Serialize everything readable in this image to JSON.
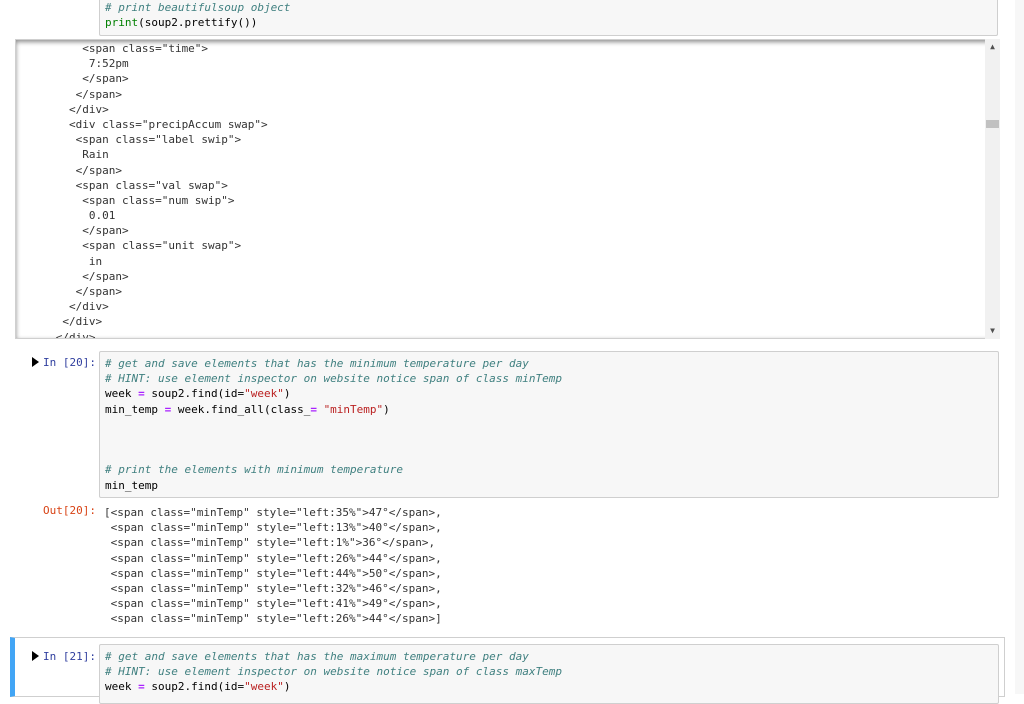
{
  "top_cell": {
    "comment": "# print beautifulsoup object",
    "code_builtin": "print",
    "code_rest": "(soup2.prettify())"
  },
  "scroll_output": {
    "lines": [
      "          <span class=\"time\">",
      "           7:52pm",
      "          </span>",
      "         </span>",
      "        </div>",
      "        <div class=\"precipAccum swap\">",
      "         <span class=\"label swip\">",
      "          Rain",
      "         </span>",
      "         <span class=\"val swap\">",
      "          <span class=\"num swip\">",
      "           0.01",
      "          </span>",
      "          <span class=\"unit swap\">",
      "           in",
      "          </span>",
      "         </span>",
      "        </div>",
      "       </div>",
      "      </div>"
    ],
    "scroll_up": "▲",
    "scroll_down": "▼"
  },
  "cell_20": {
    "in_prompt": "In [20]:",
    "comment1": "# get and save elements that has the minimum temperature per day",
    "comment2": "# HINT: use element inspector on website notice span of class minTemp",
    "line3_var": "week",
    "line3_op": "=",
    "line3_mid": "soup2.find(id=",
    "line3_str": "\"week\"",
    "line3_end": ")",
    "line4_var": "min_temp",
    "line4_op": "=",
    "line4_mid": "week.find_all(class_",
    "line4_op2": "=",
    "line4_str": "\"minTemp\"",
    "line4_end": ")",
    "comment3": "# print the elements with minimum temperature",
    "line6": "min_temp",
    "out_prompt": "Out[20]:",
    "output_lines": [
      "[<span class=\"minTemp\" style=\"left:35%\">47°</span>,",
      " <span class=\"minTemp\" style=\"left:13%\">40°</span>,",
      " <span class=\"minTemp\" style=\"left:1%\">36°</span>,",
      " <span class=\"minTemp\" style=\"left:26%\">44°</span>,",
      " <span class=\"minTemp\" style=\"left:44%\">50°</span>,",
      " <span class=\"minTemp\" style=\"left:32%\">46°</span>,",
      " <span class=\"minTemp\" style=\"left:41%\">49°</span>,",
      " <span class=\"minTemp\" style=\"left:26%\">44°</span>]"
    ]
  },
  "cell_21": {
    "in_prompt": "In [21]:",
    "comment1": "# get and save elements that has the maximum temperature per day",
    "comment2": "# HINT: use element inspector on website notice span of class maxTemp",
    "line3_var": "week",
    "line3_op": "=",
    "line3_mid": "soup2.find(id=",
    "line3_str": "\"week\"",
    "line3_end": ")"
  },
  "colors": {
    "in_prompt": "#303f9f",
    "out_prompt": "#d84315",
    "selected_cell_border": "#42a5f5",
    "comment": "#408080",
    "string": "#ba2121"
  }
}
